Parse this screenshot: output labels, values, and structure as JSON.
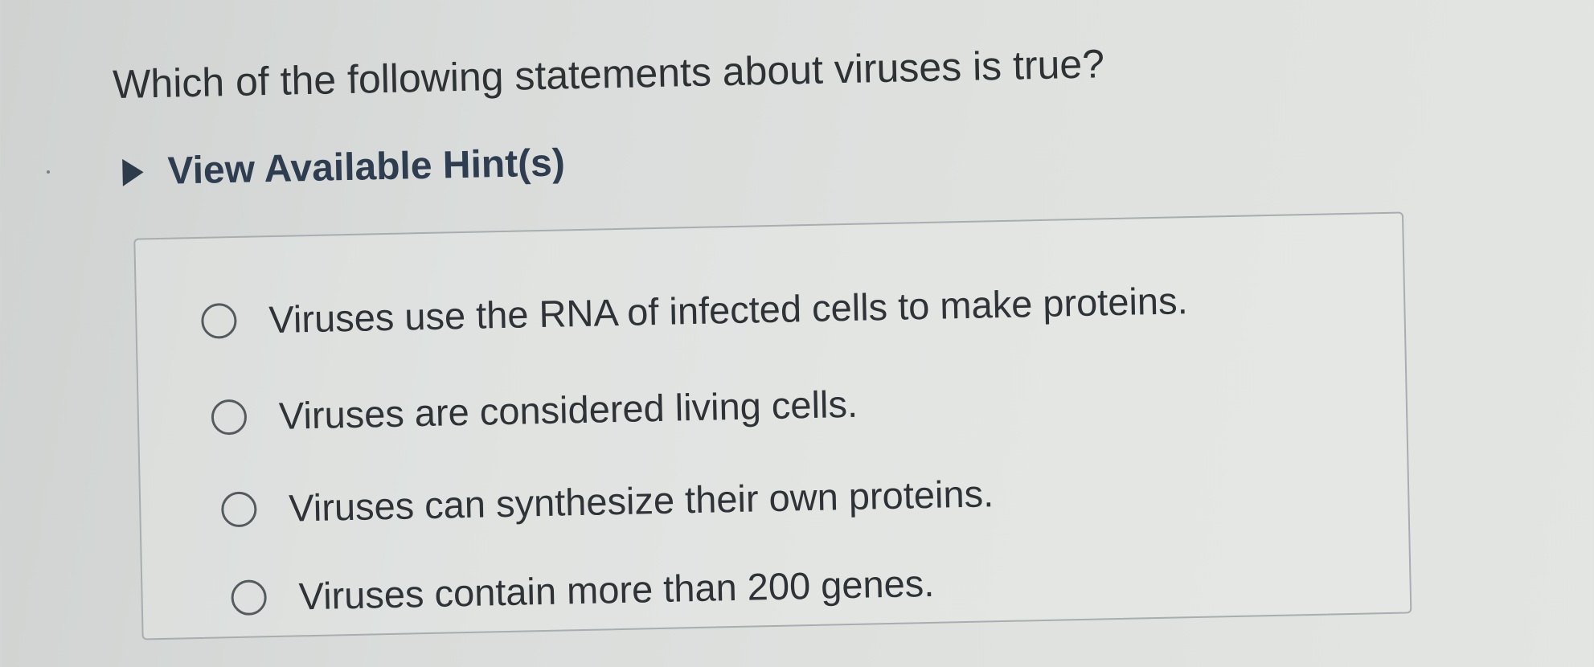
{
  "question": {
    "text": "Which of the following statements about viruses is true?"
  },
  "hint": {
    "label": "View Available Hint(s)",
    "icon": "caret-right-icon"
  },
  "options": [
    {
      "label": "Viruses use the RNA of infected cells to make proteins.",
      "selected": false
    },
    {
      "label": "Viruses are considered living cells.",
      "selected": false
    },
    {
      "label": "Viruses can synthesize their own proteins.",
      "selected": false
    },
    {
      "label": "Viruses contain more than 200 genes.",
      "selected": false
    }
  ],
  "colors": {
    "hint_text": "#2e3d4f",
    "body_text": "#2f3337",
    "panel_border": "#a9adb0"
  }
}
